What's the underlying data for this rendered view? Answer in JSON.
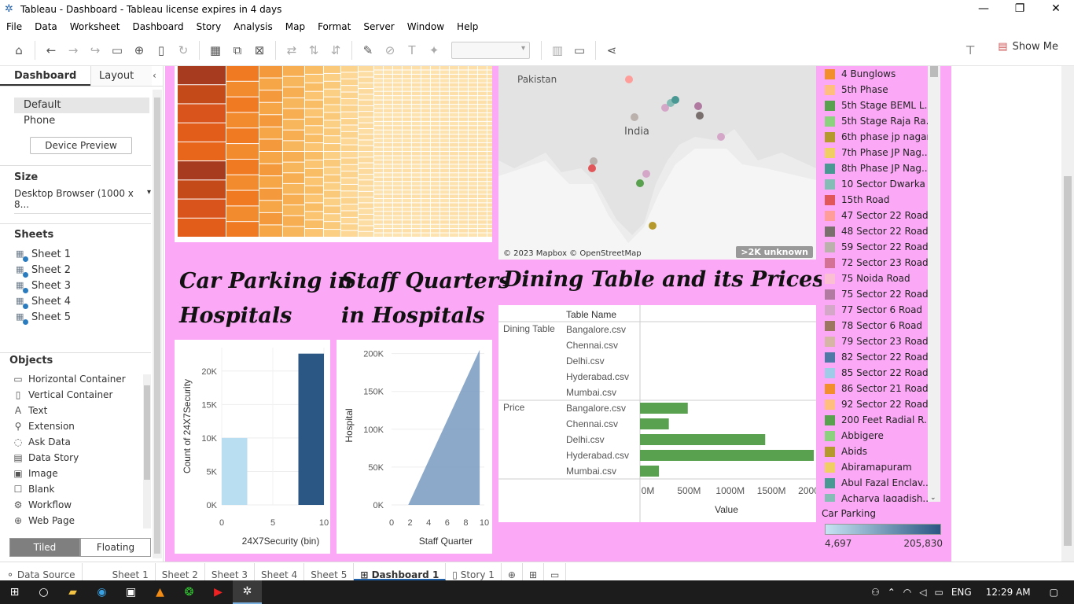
{
  "window": {
    "title": "Tableau - Dashboard - Tableau license expires in 4 days",
    "minimize": "—",
    "restore": "❐",
    "close": "✕"
  },
  "menu": [
    "File",
    "Data",
    "Worksheet",
    "Dashboard",
    "Story",
    "Analysis",
    "Map",
    "Format",
    "Server",
    "Window",
    "Help"
  ],
  "toolbar": {
    "show_me": "Show Me"
  },
  "left_panel": {
    "tabs": {
      "dashboard": "Dashboard",
      "layout": "Layout"
    },
    "device": {
      "default": "Default",
      "phone": "Phone",
      "preview_button": "Device Preview"
    },
    "size": {
      "heading": "Size",
      "value": "Desktop Browser (1000 x 8..."
    },
    "sheets": {
      "heading": "Sheets",
      "items": [
        "Sheet 1",
        "Sheet 2",
        "Sheet 3",
        "Sheet 4",
        "Sheet 5"
      ]
    },
    "objects": {
      "heading": "Objects",
      "items": [
        "Horizontal Container",
        "Vertical Container",
        "Text",
        "Extension",
        "Ask Data",
        "Data Story",
        "Image",
        "Blank",
        "Workflow",
        "Web Page"
      ]
    },
    "tiled": "Tiled",
    "floating": "Floating"
  },
  "map": {
    "label_pakistan": "Pakistan",
    "label_india": "India",
    "copyright": "© 2023 Mapbox © OpenStreetMap",
    "unknown_badge": ">2K unknown"
  },
  "titles": {
    "car_parking_1": "Car Parking in",
    "car_parking_2": "Hospitals",
    "staff_1": "Staff Quarters",
    "staff_2": "in  Hospitals",
    "dining": "Dining Table and its Prices"
  },
  "legend": {
    "items": [
      {
        "label": "4 Bunglows",
        "color": "#f28e2b"
      },
      {
        "label": "5th Phase",
        "color": "#ffbe7d"
      },
      {
        "label": "5th Stage BEML L..",
        "color": "#59a14f"
      },
      {
        "label": "5th Stage Raja Ra..",
        "color": "#8cd17d"
      },
      {
        "label": "6th phase jp nagar",
        "color": "#b6992d"
      },
      {
        "label": "7th Phase JP Nag..",
        "color": "#f1ce63"
      },
      {
        "label": "8th Phase JP Nag..",
        "color": "#499894"
      },
      {
        "label": "10 Sector Dwarka",
        "color": "#86bcb6"
      },
      {
        "label": "15th Road",
        "color": "#e15759"
      },
      {
        "label": "47 Sector 22 Road",
        "color": "#ff9d9a"
      },
      {
        "label": "48 Sector 22 Road",
        "color": "#79706e"
      },
      {
        "label": "59 Sector 22 Road",
        "color": "#bab0ac"
      },
      {
        "label": "72 Sector 23 Road",
        "color": "#d37295"
      },
      {
        "label": "75 Noida Road",
        "color": "#fabfd2"
      },
      {
        "label": "75 Sector 22 Road",
        "color": "#b07aa1"
      },
      {
        "label": "77 Sector 6 Road",
        "color": "#d4a6c8"
      },
      {
        "label": "78 Sector 6 Road",
        "color": "#9d7660"
      },
      {
        "label": "79 Sector 23 Road",
        "color": "#d7b5a6"
      },
      {
        "label": "82 Sector 22 Road",
        "color": "#4e79a7"
      },
      {
        "label": "85 Sector 22 Road",
        "color": "#a0cbe8"
      },
      {
        "label": "86 Sector 21 Road",
        "color": "#f28e2b"
      },
      {
        "label": "92 Sector 22 Road",
        "color": "#ffbe7d"
      },
      {
        "label": "200 Feet Radial R..",
        "color": "#59a14f"
      },
      {
        "label": "Abbigere",
        "color": "#8cd17d"
      },
      {
        "label": "Abids",
        "color": "#b6992d"
      },
      {
        "label": "Abiramapuram",
        "color": "#f1ce63"
      },
      {
        "label": "Abul Fazal Enclav..",
        "color": "#499894"
      },
      {
        "label": "Acharya Jagadish..",
        "color": "#86bcb6"
      }
    ],
    "color_title": "Car Parking",
    "color_min": "4,697",
    "color_max": "205,830"
  },
  "sheet_tabs": [
    "Data Source",
    "Sheet 1",
    "Sheet 2",
    "Sheet 3",
    "Sheet 4",
    "Sheet 5",
    "Dashboard 1",
    "Story 1"
  ],
  "tray": {
    "lang": "ENG",
    "time": "12:29 AM"
  },
  "chart_data": [
    {
      "type": "bar",
      "title": "Car Parking in Hospitals",
      "xlabel": "24X7Security (bin)",
      "ylabel": "Count of 24X7Security",
      "x_ticks": [
        "0",
        "5",
        "10"
      ],
      "y_ticks": [
        "0K",
        "5K",
        "10K",
        "15K",
        "20K"
      ],
      "ylim": [
        0,
        23500
      ],
      "series": [
        {
          "x_range": [
            0,
            2.5
          ],
          "value": 10000,
          "color": "#b9ddf1"
        },
        {
          "x_range": [
            7.5,
            10
          ],
          "value": 22600,
          "color": "#2a5783"
        }
      ]
    },
    {
      "type": "area",
      "title": "Staff Quarters in Hospitals",
      "xlabel": "Staff Quarter",
      "ylabel": "Hospital",
      "x_ticks": [
        "0",
        "2",
        "4",
        "6",
        "8",
        "10"
      ],
      "y_ticks": [
        "0K",
        "50K",
        "100K",
        "150K",
        "200K"
      ],
      "xlim": [
        0,
        10
      ],
      "ylim": [
        0,
        210000
      ],
      "x": [
        0.8,
        1.8,
        9.5,
        9.5
      ],
      "y": [
        0,
        0,
        205000,
        0
      ],
      "color": "#6f93bd"
    },
    {
      "type": "bar",
      "title": "Dining Table and its Prices",
      "column_header": "Table Name",
      "xlabel": "Value",
      "x_ticks": [
        "0M",
        "500M",
        "1000M",
        "1500M",
        "2000M"
      ],
      "xlim": [
        0,
        2100
      ],
      "groups": [
        {
          "name": "Dining Table",
          "rows": [
            {
              "label": "Bangalore.csv",
              "value": 0
            },
            {
              "label": "Chennai.csv",
              "value": 0
            },
            {
              "label": "Delhi.csv",
              "value": 0
            },
            {
              "label": "Hyderabad.csv",
              "value": 0
            },
            {
              "label": "Mumbai.csv",
              "value": 0
            }
          ]
        },
        {
          "name": "Price",
          "rows": [
            {
              "label": "Bangalore.csv",
              "value": 580
            },
            {
              "label": "Chennai.csv",
              "value": 350
            },
            {
              "label": "Delhi.csv",
              "value": 1520
            },
            {
              "label": "Hyderabad.csv",
              "value": 2110
            },
            {
              "label": "Mumbai.csv",
              "value": 230
            }
          ]
        }
      ],
      "color": "#59a14f"
    }
  ]
}
